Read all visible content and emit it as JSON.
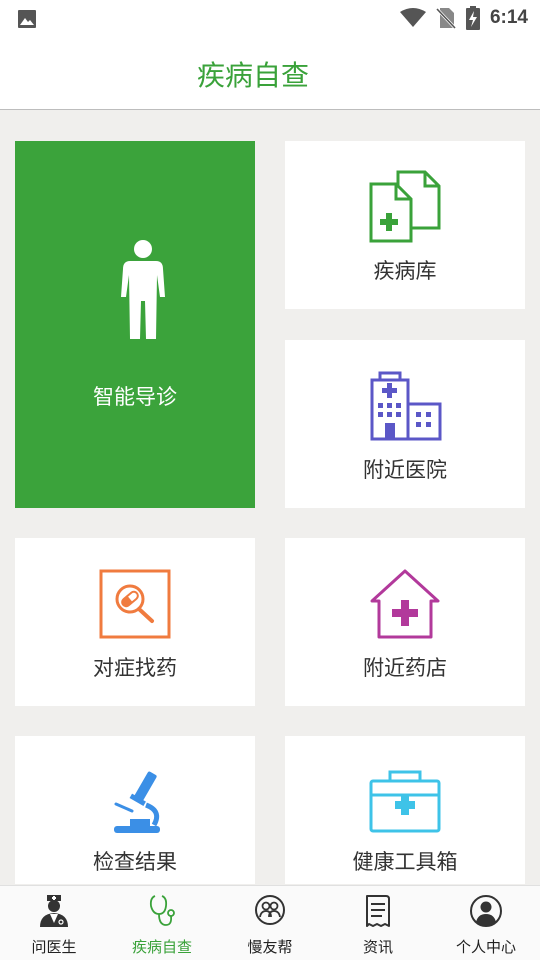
{
  "status_bar": {
    "time": "6:14"
  },
  "header": {
    "title": "疾病自查"
  },
  "tiles": [
    {
      "label": "智能导诊"
    },
    {
      "label": "疾病库"
    },
    {
      "label": "附近医院"
    },
    {
      "label": "对症找药"
    },
    {
      "label": "附近药店"
    },
    {
      "label": "检查结果"
    },
    {
      "label": "健康工具箱"
    }
  ],
  "tabs": [
    {
      "label": "问医生",
      "active": false
    },
    {
      "label": "疾病自查",
      "active": true
    },
    {
      "label": "慢友帮",
      "active": false
    },
    {
      "label": "资讯",
      "active": false
    },
    {
      "label": "个人中心",
      "active": false
    }
  ],
  "colors": {
    "brand_green": "#3aa23a",
    "tile_green": "#3ba33b",
    "orange": "#f07b3f",
    "purple": "#5b57c7",
    "magenta": "#b2399b",
    "blue": "#3b8fe6",
    "cyan": "#3ec3e8"
  }
}
